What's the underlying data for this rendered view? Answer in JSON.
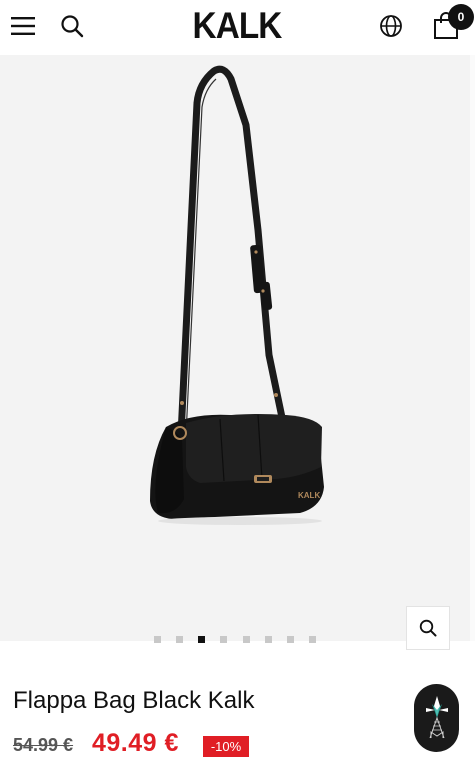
{
  "header": {
    "logo_text": "KALK",
    "menu_icon": "hamburger-menu-icon",
    "search_icon": "search-icon",
    "language_icon": "globe-icon",
    "cart_icon": "shopping-bag-icon",
    "cart_count": "0"
  },
  "gallery": {
    "image_subject": "black shoulder bag",
    "background_color": "#f3f3f3",
    "slide_count": 8,
    "active_slide": 3,
    "zoom_icon": "zoom-icon"
  },
  "product": {
    "title": "Flappa Bag Black Kalk",
    "old_price": "54.99 €",
    "new_price": "49.49 €",
    "discount": "-10%",
    "sale_color": "#e01e25"
  },
  "chat_widget": {
    "icon": "chat-widget-icon"
  }
}
